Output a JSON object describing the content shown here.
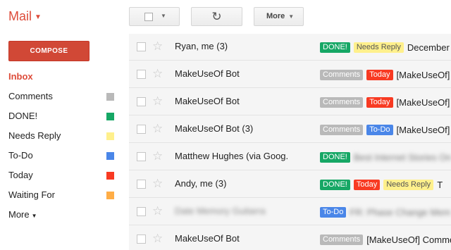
{
  "app": {
    "title": "Mail"
  },
  "toolbar": {
    "more_label": "More"
  },
  "sidebar": {
    "compose_label": "COMPOSE",
    "inbox_label": "Inbox",
    "labels": [
      {
        "name": "Comments",
        "color": "#b9b9b9"
      },
      {
        "name": "DONE!",
        "color": "#16a765"
      },
      {
        "name": "Needs Reply",
        "color": "#fff08c"
      },
      {
        "name": "To-Do",
        "color": "#4a86e8"
      },
      {
        "name": "Today",
        "color": "#f83a22"
      },
      {
        "name": "Waiting For",
        "color": "#ffad46"
      }
    ],
    "more_label": "More"
  },
  "emails": [
    {
      "sender": "Ryan, me (3)",
      "labels": [
        "DONE!",
        "Needs Reply"
      ],
      "subject": "December",
      "blurred": false
    },
    {
      "sender": "MakeUseOf Bot",
      "labels": [
        "Comments",
        "Today"
      ],
      "subject": "[MakeUseOf]",
      "blurred": false
    },
    {
      "sender": "MakeUseOf Bot",
      "labels": [
        "Comments",
        "Today"
      ],
      "subject": "[MakeUseOf]",
      "blurred": false
    },
    {
      "sender": "MakeUseOf Bot (3)",
      "labels": [
        "Comments",
        "To-Do"
      ],
      "subject": "[MakeUseOf]",
      "blurred": false
    },
    {
      "sender": "Matthew Hughes (via Goog.",
      "labels": [
        "DONE!"
      ],
      "subject": "Best Internet Stories On",
      "blurred_subject": true
    },
    {
      "sender": "Andy, me (3)",
      "labels": [
        "DONE!",
        "Today",
        "Needs Reply"
      ],
      "subject": "T",
      "blurred": false
    },
    {
      "sender": "Date Memory Guitarra",
      "labels": [
        "To-Do"
      ],
      "subject": "FR: Phase Change Mem",
      "blurred": true,
      "blurred_subject": true
    },
    {
      "sender": "MakeUseOf Bot",
      "labels": [
        "Comments"
      ],
      "subject": "[MakeUseOf] Comme",
      "blurred": false
    }
  ]
}
